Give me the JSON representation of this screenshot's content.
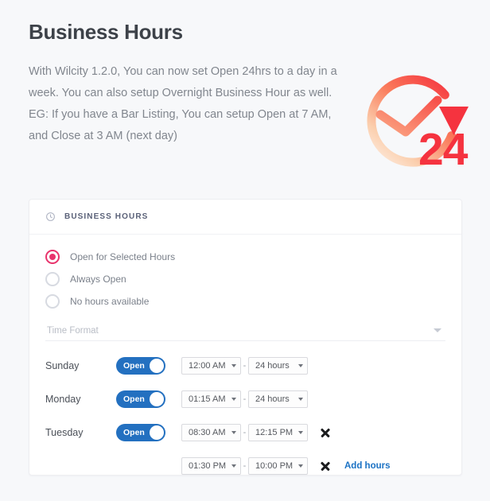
{
  "intro": {
    "title": "Business Hours",
    "body": "With Wilcity 1.2.0, You can now set Open 24hrs to a day in a week. You can also setup Overnight Business Hour as well.\nEG: If you have a Bar Listing, You can setup Open at 7 AM, and Close at 3 AM (next day)",
    "graphic": {
      "icon": "clock-24-hours-icon",
      "number_label": "24",
      "gradient_from": "#fbcfae",
      "gradient_to": "#f5333f",
      "number_color": "#f5333f"
    }
  },
  "card": {
    "header": {
      "icon": "clock-icon",
      "title": "BUSINESS HOURS"
    },
    "options": [
      {
        "label": "Open for Selected Hours",
        "selected": true
      },
      {
        "label": "Always Open",
        "selected": false
      },
      {
        "label": "No hours available",
        "selected": false
      }
    ],
    "time_format": {
      "placeholder": "Time Format",
      "value": "",
      "icon": "chevron-down-icon"
    },
    "toggle_on_label": "Open",
    "range_separator": "-",
    "remove_icon": "close-icon",
    "add_hours_label": "Add hours",
    "days": [
      {
        "name": "Sunday",
        "open": true,
        "ranges": [
          {
            "start": "12:00 AM",
            "end": "24 hours",
            "removable": false
          }
        ]
      },
      {
        "name": "Monday",
        "open": true,
        "ranges": [
          {
            "start": "01:15 AM",
            "end": "24 hours",
            "removable": false
          }
        ]
      },
      {
        "name": "Tuesday",
        "open": true,
        "ranges": [
          {
            "start": "08:30 AM",
            "end": "12:15 PM",
            "removable": true
          },
          {
            "start": "01:30 PM",
            "end": "10:00 PM",
            "removable": true,
            "add_hours": true
          }
        ]
      }
    ]
  },
  "colors": {
    "page_background": "#f7f8fa",
    "card_background": "#ffffff",
    "accent_radio": "#e8336c",
    "accent_toggle": "#2370c0",
    "accent_link": "#1b72c4",
    "title_text": "#3d4249",
    "body_text": "#81868e"
  }
}
